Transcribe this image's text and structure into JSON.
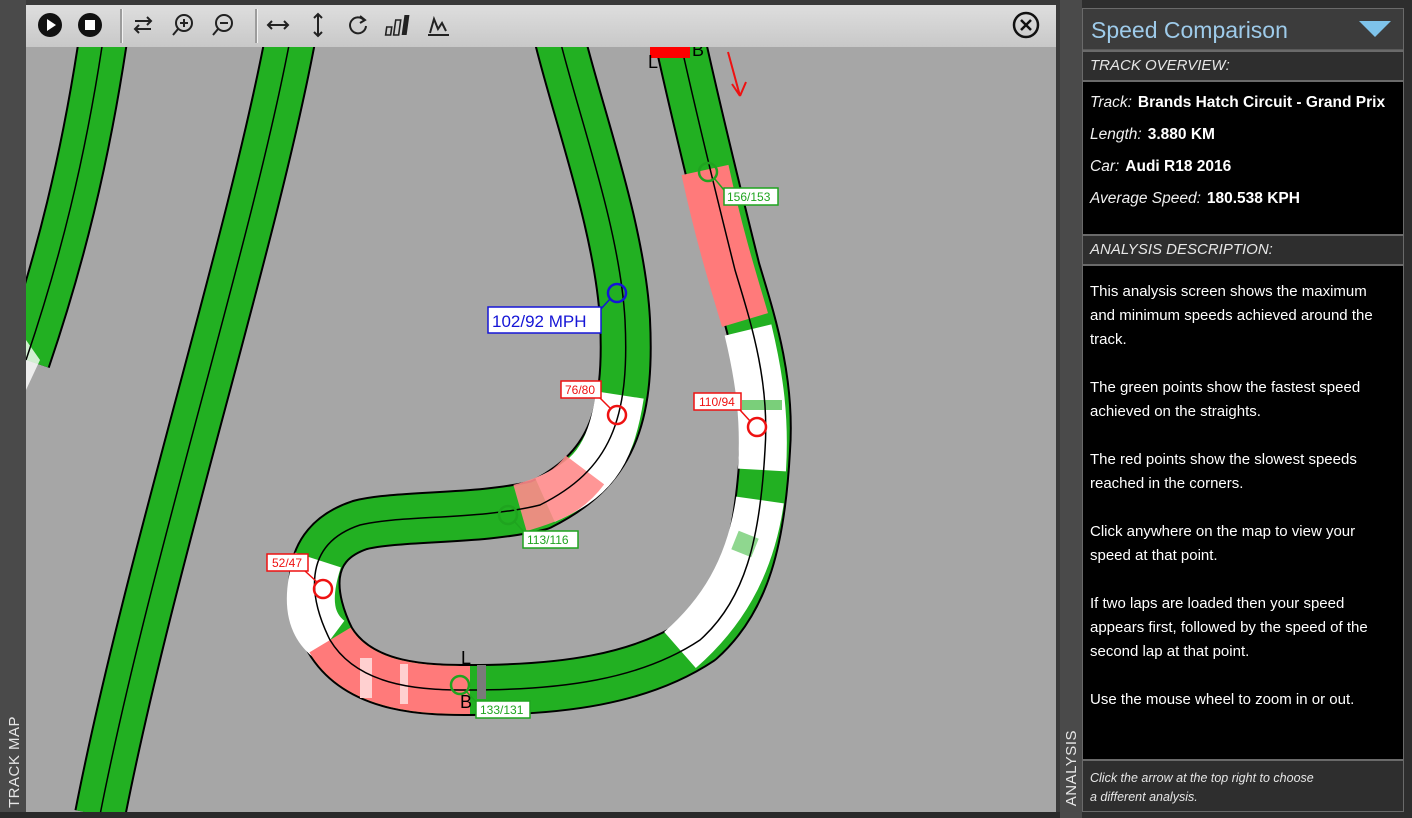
{
  "track_map": {
    "vertical_label": "TRACK MAP",
    "toolbar": {
      "buttons": [
        {
          "name": "play-icon",
          "icon": "play"
        },
        {
          "name": "stop-icon",
          "icon": "stop"
        },
        {
          "name": "swap-icon",
          "icon": "swap"
        },
        {
          "name": "zoom-in-icon",
          "icon": "zoom-in"
        },
        {
          "name": "zoom-out-icon",
          "icon": "zoom-out"
        },
        {
          "name": "fit-horizontal-icon",
          "icon": "fit-horizontal"
        },
        {
          "name": "fit-vertical-icon",
          "icon": "fit-vertical"
        },
        {
          "name": "rotate-icon",
          "icon": "rotate"
        },
        {
          "name": "bars-icon",
          "icon": "bars"
        },
        {
          "name": "graph-icon",
          "icon": "graph"
        }
      ],
      "close_icon": "close"
    },
    "speed_labels": {
      "cursor": "102/92 MPH",
      "p1": "156/153",
      "p2": "76/80",
      "p3": "110/94",
      "p4": "113/116",
      "p5": "52/47",
      "p6": "133/131"
    },
    "marker_letters": {
      "top_l": "L",
      "top_b": "B",
      "bottom_l": "L",
      "bottom_b": "B"
    },
    "colors": {
      "background": "#a6a6a6",
      "track": "#22b022",
      "fast_point": "#1fa41f",
      "slow_point": "#ee1111",
      "cursor": "#1515d6",
      "slow_section": "#ff7a7a"
    }
  },
  "analysis": {
    "vertical_label": "ANALYSIS",
    "title": "Speed Comparison",
    "overview_heading": "TRACK OVERVIEW:",
    "overview": [
      {
        "key": "Track:",
        "value": "Brands Hatch Circuit - Grand Prix"
      },
      {
        "key": "Length:",
        "value": "3.880 KM"
      },
      {
        "key": "Car:",
        "value": "Audi R18 2016"
      },
      {
        "key": "Average Speed:",
        "value": "180.538 KPH"
      }
    ],
    "description_heading": "ANALYSIS DESCRIPTION:",
    "description": [
      "This analysis screen shows the maximum and minimum speeds achieved around the track.",
      "The green points show the fastest speed achieved on the straights.",
      "The red points show the slowest speeds reached in the corners.",
      "Click anywhere on the map to view your speed at that point.",
      "If two laps are loaded then your speed appears first, followed by the speed of the second lap at that point.",
      "Use the mouse wheel to zoom in or out."
    ],
    "footer_line1": "Click the arrow at the top right to choose",
    "footer_line2": "a different analysis."
  }
}
